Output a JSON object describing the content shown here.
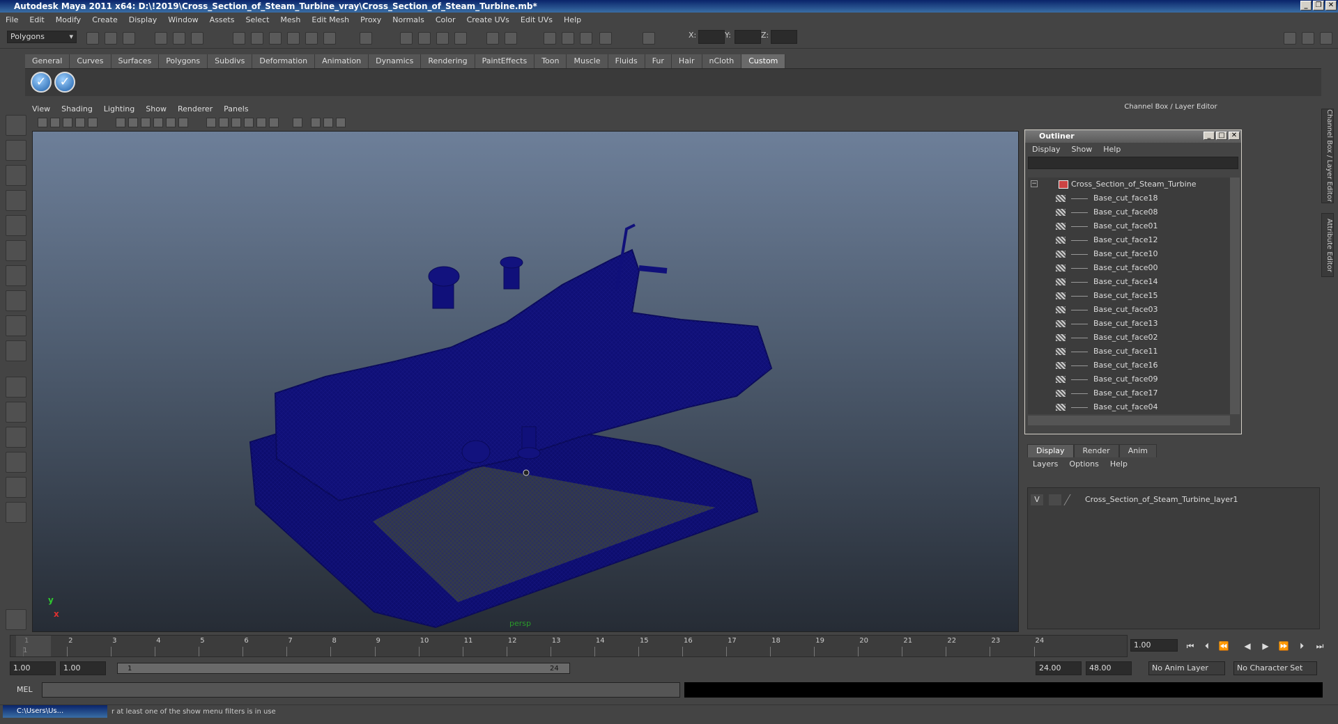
{
  "title": "Autodesk Maya 2011 x64: D:\\!2019\\Cross_Section_of_Steam_Turbine_vray\\Cross_Section_of_Steam_Turbine.mb*",
  "menus": [
    "File",
    "Edit",
    "Modify",
    "Create",
    "Display",
    "Window",
    "Assets",
    "Select",
    "Mesh",
    "Edit Mesh",
    "Proxy",
    "Normals",
    "Color",
    "Create UVs",
    "Edit UVs",
    "Help"
  ],
  "mode_menu": "Polygons",
  "coords": {
    "x_label": "X:",
    "y_label": "Y:",
    "z_label": "Z:"
  },
  "shelf_tabs": [
    "General",
    "Curves",
    "Surfaces",
    "Polygons",
    "Subdivs",
    "Deformation",
    "Animation",
    "Dynamics",
    "Rendering",
    "PaintEffects",
    "Toon",
    "Muscle",
    "Fluids",
    "Fur",
    "Hair",
    "nCloth",
    "Custom"
  ],
  "shelf_active": "Custom",
  "panel_menus": [
    "View",
    "Shading",
    "Lighting",
    "Show",
    "Renderer",
    "Panels"
  ],
  "viewport": {
    "camera_label": "persp",
    "axis_y": "y",
    "axis_x": "x"
  },
  "channel_box_header": "Channel Box / Layer Editor",
  "outliner": {
    "title": "Outliner",
    "menus": [
      "Display",
      "Show",
      "Help"
    ],
    "root": "Cross_Section_of_Steam_Turbine",
    "items": [
      "Base_cut_face18",
      "Base_cut_face08",
      "Base_cut_face01",
      "Base_cut_face12",
      "Base_cut_face10",
      "Base_cut_face00",
      "Base_cut_face14",
      "Base_cut_face15",
      "Base_cut_face03",
      "Base_cut_face13",
      "Base_cut_face02",
      "Base_cut_face11",
      "Base_cut_face16",
      "Base_cut_face09",
      "Base_cut_face17",
      "Base_cut_face04"
    ]
  },
  "layer_editor": {
    "tabs": [
      "Display",
      "Render",
      "Anim"
    ],
    "active_tab": "Display",
    "menus": [
      "Layers",
      "Options",
      "Help"
    ],
    "layer_visibility": "V",
    "layer_name": "Cross_Section_of_Steam_Turbine_layer1"
  },
  "side_tabs": [
    "Channel Box / Layer Editor",
    "Attribute Editor"
  ],
  "timeline": {
    "ticks": [
      "1",
      "2",
      "3",
      "4",
      "5",
      "6",
      "7",
      "8",
      "9",
      "10",
      "11",
      "12",
      "13",
      "14",
      "15",
      "16",
      "17",
      "18",
      "19",
      "20",
      "21",
      "22",
      "23",
      "24"
    ],
    "current_frame": "1.00",
    "marker": "1"
  },
  "range": {
    "start": "1.00",
    "playback_start": "1.00",
    "slider_start": "1",
    "slider_end": "24",
    "playback_end": "24.00",
    "end": "48.00",
    "anim_layer": "No Anim Layer",
    "character_set": "No Character Set"
  },
  "mel_label": "MEL",
  "help_line": "r at least one of the show menu filters is in use",
  "taskbar_item": "C:\\Users\\Us..."
}
